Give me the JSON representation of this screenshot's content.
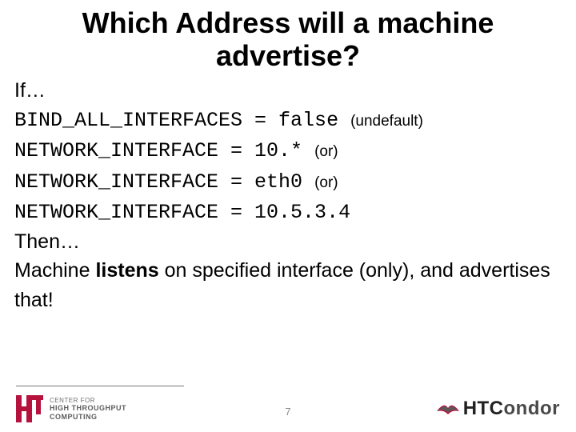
{
  "title": "Which Address will  a machine advertise?",
  "lines": {
    "if": "If…",
    "l1_code": "BIND_ALL_INTERFACES = false ",
    "l1_note": "(undefault)",
    "l2_code": "NETWORK_INTERFACE = 10.* ",
    "l2_note": "(or)",
    "l3_code": "NETWORK_INTERFACE = eth0 ",
    "l3_note": "(or)",
    "l4_code": "NETWORK_INTERFACE = 10.5.3.4",
    "then": "Then…",
    "conclusion_a": "Machine ",
    "conclusion_b": "listens",
    "conclusion_c": " on specified interface (only), and advertises that!"
  },
  "footer": {
    "page": "7",
    "chtc_line1": "CENTER FOR",
    "chtc_line2": "HIGH THROUGHPUT",
    "chtc_line3": "COMPUTING",
    "condor_ht": "HTC",
    "condor_rest": "ondor"
  }
}
